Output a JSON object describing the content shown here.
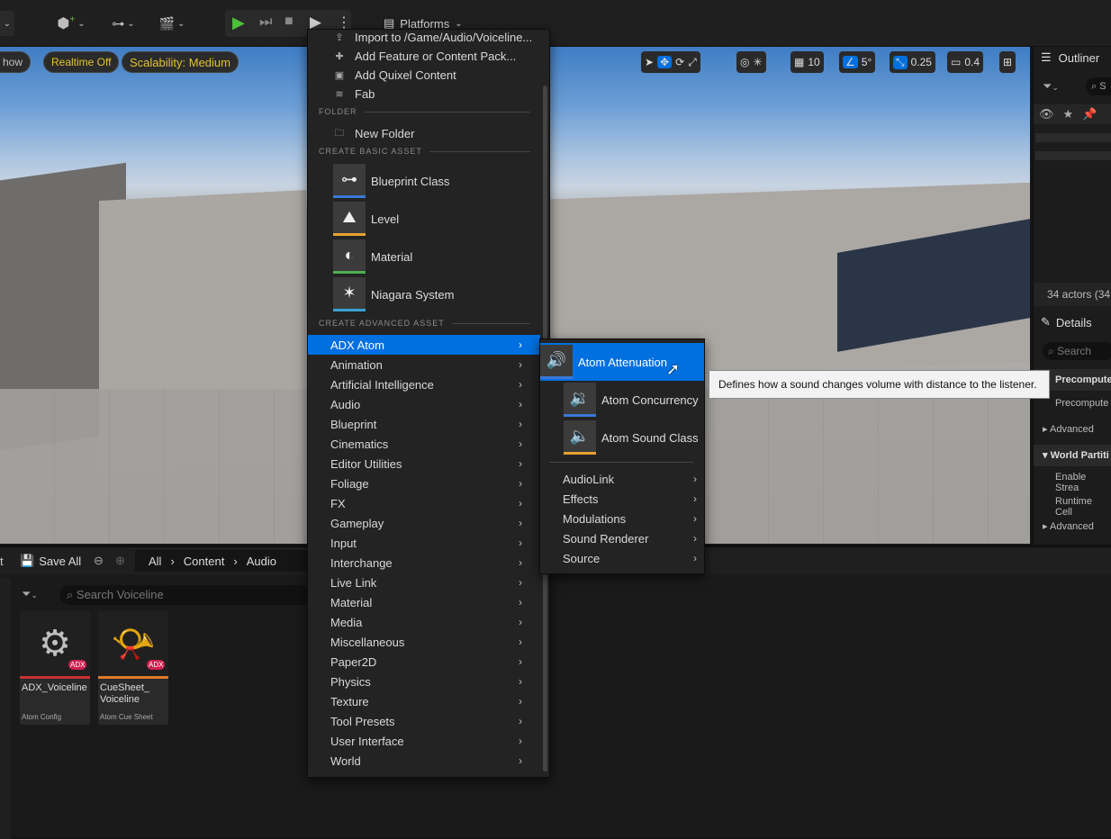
{
  "toolbar": {
    "platforms_label": "Platforms"
  },
  "viewport": {
    "show_label": "how",
    "realtime_label": "Realtime Off",
    "scalability_label": "Scalability: Medium",
    "grid_value": "10",
    "angle_value": "5°",
    "scale_value": "0.25",
    "camera_value": "0.4"
  },
  "outliner": {
    "title": "Outliner",
    "search_placeholder": "S",
    "actor_count": "34 actors (34",
    "details_title": "Details",
    "details_search_placeholder": "Search",
    "rows": [
      "Precompute",
      "Precompute",
      "Advanced",
      "World Partiti",
      "Enable Strea",
      "Runtime Cell",
      "Advanced"
    ]
  },
  "content_browser": {
    "save_all_label": "Save All",
    "left_label": "t",
    "breadcrumbs": [
      "All",
      "Content",
      "Audio"
    ],
    "search_placeholder": "Search Voiceline",
    "assets": [
      {
        "name": "ADX_Voiceline",
        "type": "Atom Config",
        "badge": "ADX",
        "color": "#c83232"
      },
      {
        "name": "CueSheet_\nVoiceline",
        "type": "Atom Cue Sheet",
        "badge": "ADX",
        "color": "#e07a28"
      }
    ]
  },
  "menu": {
    "top_items": [
      {
        "label": "Import to /Game/Audio/Voiceline...",
        "icon": "import-icon"
      },
      {
        "label": "Add Feature or Content Pack...",
        "icon": "feature-pack-icon"
      },
      {
        "label": "Add Quixel Content",
        "icon": "quixel-icon"
      },
      {
        "label": "Fab",
        "icon": "fab-icon"
      }
    ],
    "folder_section": "FOLDER",
    "new_folder": "New Folder",
    "basic_section": "CREATE BASIC ASSET",
    "basic_items": [
      {
        "label": "Blueprint Class",
        "icon": "blueprint-class-icon",
        "color": "#3a78d8"
      },
      {
        "label": "Level",
        "icon": "level-icon",
        "color": "#e8a030"
      },
      {
        "label": "Material",
        "icon": "material-icon",
        "color": "#4caf50"
      },
      {
        "label": "Niagara System",
        "icon": "niagara-icon",
        "color": "#3aa0d0"
      }
    ],
    "advanced_section": "CREATE ADVANCED ASSET",
    "advanced_items": [
      "ADX Atom",
      "Animation",
      "Artificial Intelligence",
      "Audio",
      "Blueprint",
      "Cinematics",
      "Editor Utilities",
      "Foliage",
      "FX",
      "Gameplay",
      "Input",
      "Interchange",
      "Live Link",
      "Material",
      "Media",
      "Miscellaneous",
      "Paper2D",
      "Physics",
      "Texture",
      "Tool Presets",
      "User Interface",
      "World"
    ]
  },
  "submenu": {
    "big_items": [
      {
        "label": "Atom Attenuation",
        "icon": "atom-attenuation-icon",
        "color": "#3a78d8"
      },
      {
        "label": "Atom Concurrency",
        "icon": "atom-concurrency-icon",
        "color": "#3a78d8"
      },
      {
        "label": "Atom Sound Class",
        "icon": "atom-sound-class-icon",
        "color": "#e8a030"
      }
    ],
    "items": [
      "AudioLink",
      "Effects",
      "Modulations",
      "Sound Renderer",
      "Source"
    ]
  },
  "tooltip": "Defines how a sound changes volume with distance to the listener."
}
